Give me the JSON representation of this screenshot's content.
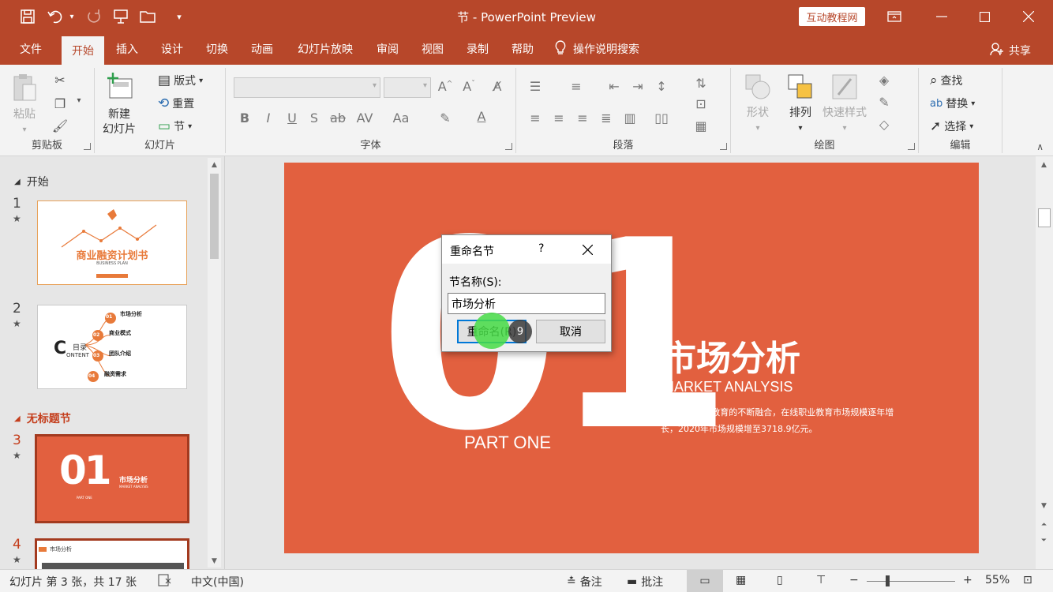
{
  "app": {
    "title": "节 - PowerPoint Preview",
    "brand_badge": "互动教程网"
  },
  "tabs": [
    "文件",
    "开始",
    "插入",
    "设计",
    "切换",
    "动画",
    "幻灯片放映",
    "审阅",
    "视图",
    "录制",
    "帮助"
  ],
  "tell_me": "操作说明搜索",
  "share": "共享",
  "ribbon": {
    "clipboard": {
      "paste": "粘贴",
      "label": "剪贴板"
    },
    "slides": {
      "new_slide_1": "新建",
      "new_slide_2": "幻灯片",
      "layout": "版式",
      "reset": "重置",
      "section": "节",
      "label": "幻灯片"
    },
    "font": {
      "label": "字体"
    },
    "paragraph": {
      "label": "段落"
    },
    "drawing": {
      "shapes": "形状",
      "arrange": "排列",
      "quick_styles": "快速样式",
      "label": "绘图"
    },
    "editing": {
      "find": "查找",
      "replace": "替换",
      "select": "选择",
      "label": "编辑"
    }
  },
  "thumbnails": {
    "section1": "开始",
    "section2": "无标题节",
    "slides": [
      {
        "num": "1",
        "title": "商业融资计划书",
        "subtitle": "BUSINESS PLAN"
      },
      {
        "num": "2",
        "title_c": "C",
        "title_mulu": "目录",
        "title_ontent": "ONTENT",
        "items": [
          "01",
          "市场分析",
          "02",
          "商业模式",
          "03",
          "团队介绍",
          "04",
          "融资需求"
        ]
      },
      {
        "num": "3",
        "big": "01",
        "title": "市场分析",
        "sub": "MARKET ANALYSIS",
        "part": "PART ONE"
      },
      {
        "num": "4",
        "title": "市场分析"
      }
    ]
  },
  "slide": {
    "big_number": "01",
    "part": "PART ONE",
    "title": "市场分析",
    "subtitle": "MARKET ANALYSIS",
    "body": "随着互联网+教育的不断融合，在线职业教育市场规模逐年增长，2020年市场规模增至3718.9亿元。"
  },
  "dialog": {
    "title": "重命名节",
    "help": "?",
    "field_label": "节名称(S):",
    "field_value": "市场分析",
    "ok_label": "重命名(R)",
    "cancel_label": "取消",
    "cursor_badge": "9"
  },
  "status": {
    "slide_info": "幻灯片 第 3 张，共 17 张",
    "language": "中文(中国)",
    "notes": "备注",
    "comments": "批注",
    "zoom": "55%"
  },
  "colors": {
    "accent": "#b7472a",
    "slide_bg": "#e2603f",
    "section_red": "#c43e1c"
  }
}
